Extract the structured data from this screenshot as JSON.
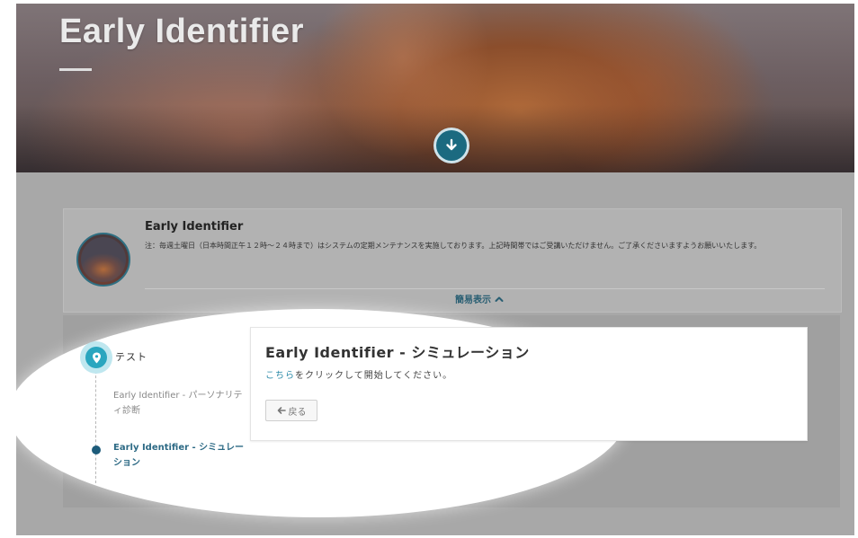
{
  "hero": {
    "title": "Early Identifier"
  },
  "course": {
    "title": "Early Identifier",
    "note": "注：毎週土曜日（日本時間正午１２時～２４時まで）はシステムの定期メンテナンスを実施しております。上記時間帯ではご受講いただけません。ご了承くださいますようお願いいたします。",
    "toggle_label": "簡易表示"
  },
  "timeline": {
    "section_label": "テスト",
    "steps": [
      {
        "label": "Early Identifier - パーソナリティ診断",
        "state": "inactive"
      },
      {
        "label": "Early Identifier - シミュレーション",
        "state": "active"
      }
    ]
  },
  "module": {
    "title": "Early Identifier - シミュレーション",
    "instruction_link": "こちら",
    "instruction_text": "をクリックして開始してください。",
    "back_label": "戻る"
  },
  "colors": {
    "accent": "#2aa6bf",
    "active_step": "#1d5b7a",
    "link": "#2a8aa8",
    "highlight": "#ffffff"
  },
  "icons": {
    "scroll": "arrow-down-circle-icon",
    "toggle": "chevron-up-icon",
    "pin": "map-pin-icon",
    "back": "arrow-left-icon"
  }
}
